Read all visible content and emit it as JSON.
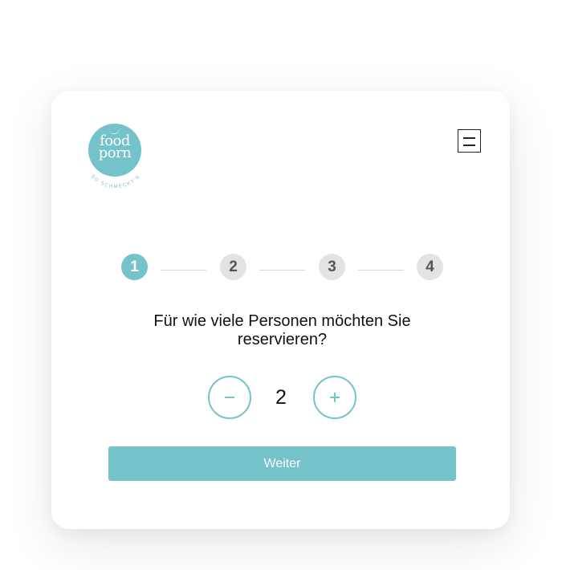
{
  "logo": {
    "line1": "food",
    "line2": "porn",
    "tagline": "SO SCHMECKT'S",
    "color": "#74c3cb"
  },
  "menu": {
    "icon": "hamburger-menu-icon"
  },
  "steps": {
    "items": [
      {
        "label": "1",
        "active": true
      },
      {
        "label": "2",
        "active": false
      },
      {
        "label": "3",
        "active": false
      },
      {
        "label": "4",
        "active": false
      }
    ],
    "active_color": "#74c3cb",
    "inactive_color": "#e3e3e3"
  },
  "question": "Für wie viele Personen möchten Sie reservieren?",
  "counter": {
    "value": "2",
    "minus_icon": "minus-icon",
    "plus_icon": "plus-icon"
  },
  "next_button": {
    "label": "Weiter"
  }
}
